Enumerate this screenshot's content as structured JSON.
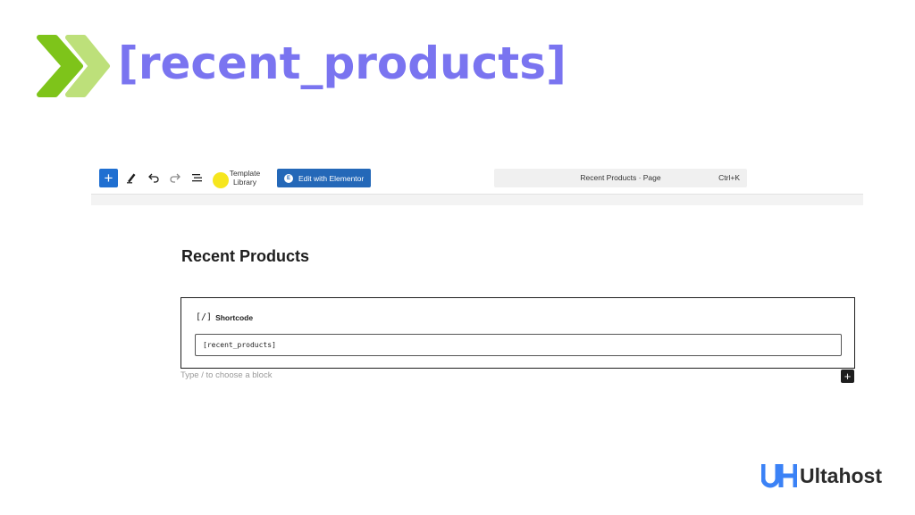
{
  "banner": {
    "title": "[recent_products]",
    "chevron_icon": "double-chevron-right",
    "colors": {
      "chevron_dark": "#7ec41a",
      "chevron_light": "#bde07a",
      "title": "#7a74f0"
    }
  },
  "toolbar": {
    "add_icon": "plus-icon",
    "add_glyph": "+",
    "tools_icon": "pencil-icon",
    "undo_icon": "undo-icon",
    "redo_icon": "redo-icon",
    "outline_icon": "document-overview-icon",
    "template_library_line1": "Template",
    "template_library_line2": "Library",
    "elementor_label": "Edit with Elementor",
    "elementor_logo": "E",
    "command_title": "Recent Products · Page",
    "command_shortcut": "Ctrl+K",
    "colors": {
      "primary": "#1f6fd1",
      "elementor": "#2468b8",
      "template_dot": "#f6e61e"
    }
  },
  "editor": {
    "post_title": "Recent Products",
    "shortcode_block": {
      "icon": "[/]",
      "label": "Shortcode",
      "value": "[recent_products]"
    },
    "appender_placeholder": "Type / to choose a block",
    "appender_add_glyph": "+"
  },
  "brand": {
    "name": "Ultahost",
    "colors": {
      "mark": "#3b82f6",
      "text": "#2b2b2b"
    }
  }
}
